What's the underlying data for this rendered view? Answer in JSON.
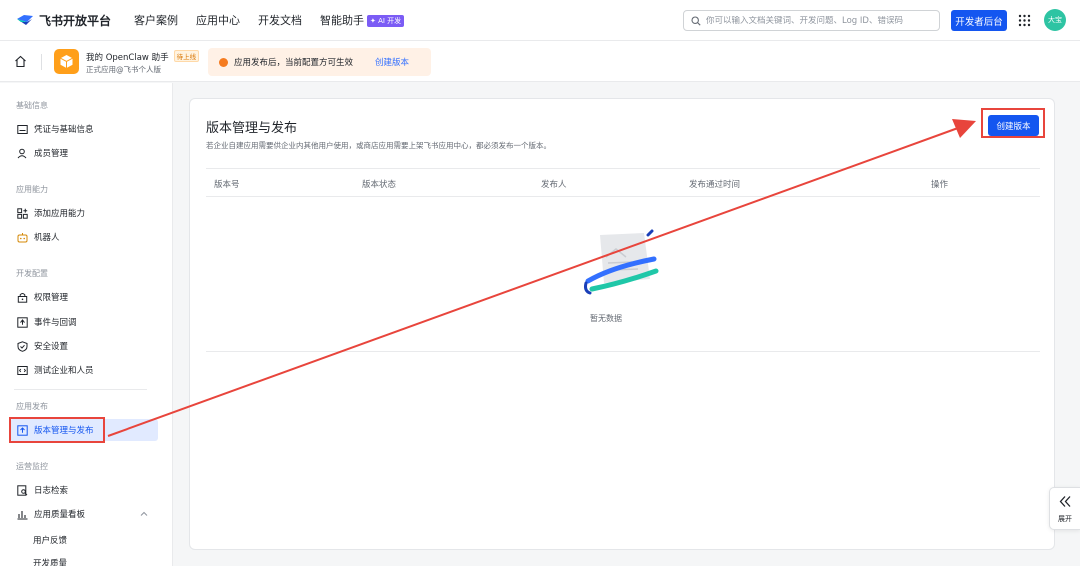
{
  "topnav": {
    "logo_text": "飞书开放平台",
    "links": [
      "客户案例",
      "应用中心",
      "开发文档",
      "智能助手"
    ],
    "ai_badge": "✦ AI 开发",
    "search_placeholder": "你可以输入文档关键词、开发问题、Log ID、错误码",
    "dev_console": "开发者后台",
    "avatar_text": "大宝"
  },
  "appbar": {
    "app_name": "我的 OpenClaw 助手",
    "app_status": "待上线",
    "app_sub": "正式应用@飞书个人版",
    "notice_text": "应用发布后，当前配置方可生效",
    "notice_link": "创建版本"
  },
  "sidebar": {
    "groups": [
      {
        "title": "基础信息",
        "items": [
          "凭证与基础信息",
          "成员管理"
        ]
      },
      {
        "title": "应用能力",
        "items": [
          "添加应用能力",
          "机器人"
        ]
      },
      {
        "title": "开发配置",
        "items": [
          "权限管理",
          "事件与回调",
          "安全设置",
          "测试企业和人员"
        ]
      },
      {
        "title": "应用发布",
        "items": [
          "版本管理与发布"
        ]
      },
      {
        "title": "运营监控",
        "items": [
          "日志检索",
          "应用质量看板"
        ]
      }
    ],
    "sub_items": [
      "用户反馈",
      "开发质量"
    ]
  },
  "main": {
    "title": "版本管理与发布",
    "description": "若企业自建应用需要供企业内其他用户使用，或商店应用需要上架飞书应用中心，都必须发布一个版本。",
    "create_button": "创建版本",
    "columns": [
      "版本号",
      "版本状态",
      "发布人",
      "发布通过时间",
      "操作"
    ],
    "empty_text": "暂无数据"
  },
  "expand": {
    "label": "展开"
  },
  "colors": {
    "primary": "#1456f0",
    "annotation": "#e8453c",
    "accent_orange": "#ff9f1a"
  }
}
